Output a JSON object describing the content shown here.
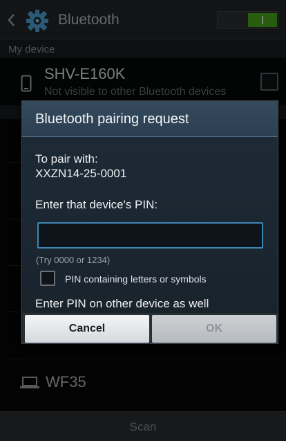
{
  "settings": {
    "title": "Bluetooth",
    "bluetooth_toggle": "on",
    "section_my_device": "My device",
    "my_device": {
      "name": "SHV-E160K",
      "subtitle": "Not visible to other Bluetooth devices"
    },
    "available_devices": [
      {
        "name": "WF35",
        "icon": "laptop-icon"
      }
    ],
    "scan_label": "Scan"
  },
  "dialog": {
    "title": "Bluetooth pairing request",
    "pair_with_label": "To pair with:",
    "pair_with_device": "XXZN14-25-0001",
    "pin_label": "Enter that device's PIN:",
    "pin_value": "",
    "pin_hint": "(Try 0000 or 1234)",
    "letters_checkbox_label": "PIN containing letters or symbols",
    "letters_checked": false,
    "other_device_note": "Enter PIN on other device as well",
    "cancel_label": "Cancel",
    "ok_label": "OK"
  },
  "colors": {
    "accent_blue": "#3f86b4",
    "toggle_green": "#49a91e",
    "dialog_title_bg": "#2f4356"
  }
}
